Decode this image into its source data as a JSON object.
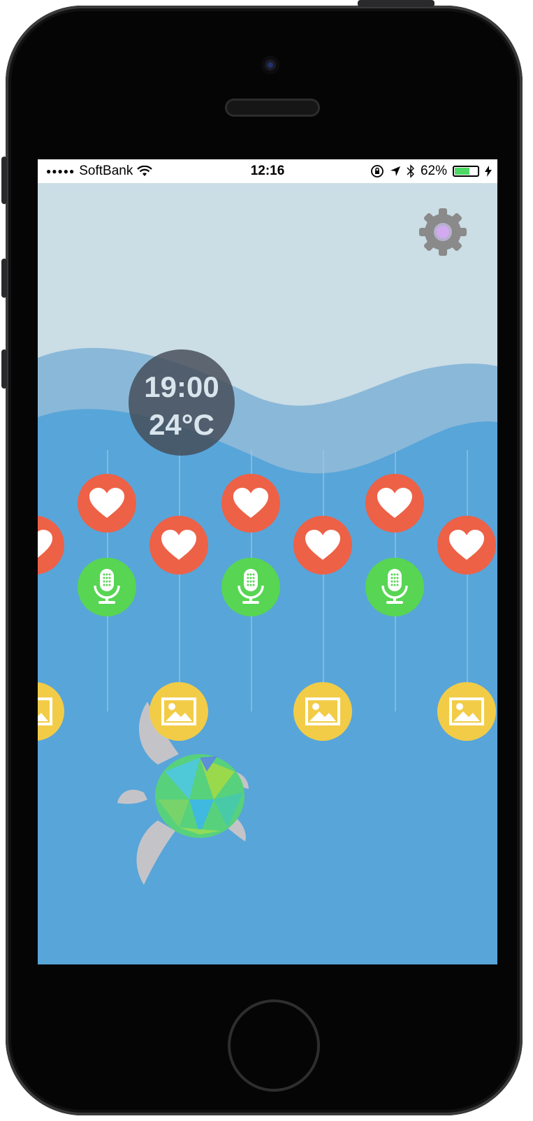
{
  "status_bar": {
    "carrier": "SoftBank",
    "time": "12:16",
    "battery_percent": "62%",
    "battery_level": 0.62
  },
  "main": {
    "time_display": "19:00",
    "temperature_display": "24°C",
    "settings_icon": "gear-icon",
    "turtle_icon": "sea-turtle-icon"
  },
  "colors": {
    "sky": "#cbdde5",
    "wave_light": "#8ab8d9",
    "water": "#58a5d9",
    "heart_bubble": "#ed6147",
    "mic_bubble": "#57d553",
    "image_bubble": "#f2cc47"
  },
  "bubbles": [
    {
      "type": "heart-icon"
    },
    {
      "type": "microphone-icon"
    },
    {
      "type": "image-icon"
    }
  ]
}
